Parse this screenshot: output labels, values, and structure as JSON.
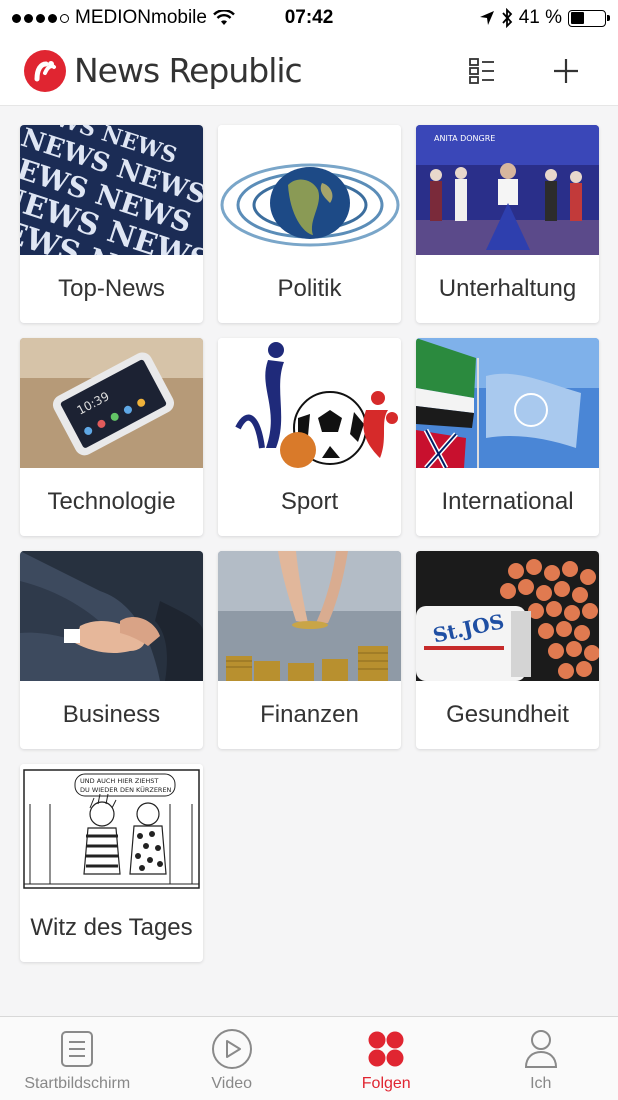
{
  "status_bar": {
    "carrier": "MEDIONmobile",
    "time": "07:42",
    "battery": "41 %",
    "battery_level": 0.41
  },
  "header": {
    "logo_text": "News Republic",
    "brand_color": "#e02531",
    "list_view_icon": "list-view-icon",
    "add_icon": "plus-icon"
  },
  "categories": [
    {
      "label": "Top-News",
      "image": "news-text-photo"
    },
    {
      "label": "Politik",
      "image": "globe-water-photo"
    },
    {
      "label": "Unterhaltung",
      "image": "fashion-runway-photo"
    },
    {
      "label": "Technologie",
      "image": "smartphone-photo"
    },
    {
      "label": "Sport",
      "image": "sports-figures-photo"
    },
    {
      "label": "International",
      "image": "flags-photo"
    },
    {
      "label": "Business",
      "image": "handshake-photo"
    },
    {
      "label": "Finanzen",
      "image": "coins-photo"
    },
    {
      "label": "Gesundheit",
      "image": "pills-photo"
    },
    {
      "label": "Witz des Tages",
      "image": "comic-strip-photo"
    }
  ],
  "comic_caption": "UND AUCH HIER ZIEHST DU WIEDER DEN KÜRZEREN",
  "tabbar": {
    "tabs": [
      {
        "label": "Startbildschirm",
        "icon": "document-icon",
        "active": false
      },
      {
        "label": "Video",
        "icon": "play-icon",
        "active": false
      },
      {
        "label": "Folgen",
        "icon": "follow-grid-icon",
        "active": true
      },
      {
        "label": "Ich",
        "icon": "person-icon",
        "active": false
      }
    ]
  }
}
